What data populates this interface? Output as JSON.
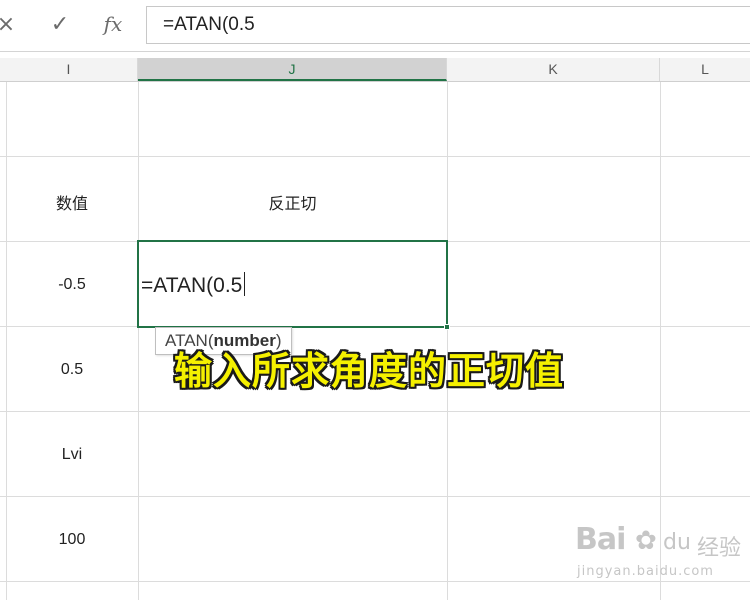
{
  "formula_bar": {
    "cancel_icon": "×",
    "enter_icon": "✓",
    "fx_label": "fx",
    "formula": "=ATAN(0.5"
  },
  "columns": [
    {
      "label": "I",
      "selected": false
    },
    {
      "label": "J",
      "selected": true
    },
    {
      "label": "K",
      "selected": false
    },
    {
      "label": "L",
      "selected": false
    }
  ],
  "cells": {
    "header_i": "数值",
    "header_j": "反正切",
    "i_row1": "-0.5",
    "i_row2": "0.5",
    "i_row3": "Lvi",
    "i_row4": "100"
  },
  "active_cell": {
    "editing_text": "=ATAN(0.5"
  },
  "tooltip": {
    "function_name": "ATAN",
    "open_paren": "(",
    "argument": "number",
    "close_paren": ")"
  },
  "caption": "输入所求角度的正切值",
  "watermark": {
    "logo": "Bai",
    "logo_suffix": "du",
    "cn": "经验",
    "url": "jingyan.baidu.com"
  },
  "colors": {
    "excel_green": "#217346",
    "caption_yellow": "#f5f000"
  }
}
